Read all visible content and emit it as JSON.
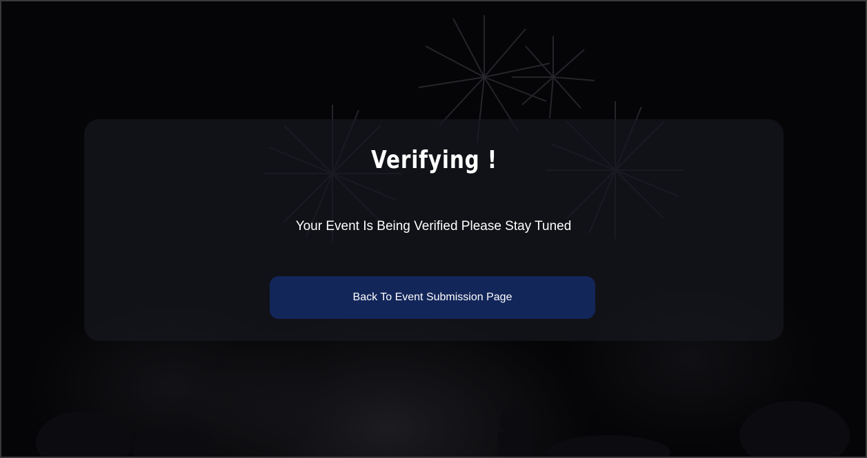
{
  "verification": {
    "title": "Verifying !",
    "message": "Your Event Is Being Verified Please Stay Tuned",
    "back_button_label": "Back To Event Submission Page"
  },
  "colors": {
    "background": "#050507",
    "card": "rgba(22,24,30,0.72)",
    "button": "#13265a",
    "text": "#ffffff"
  }
}
